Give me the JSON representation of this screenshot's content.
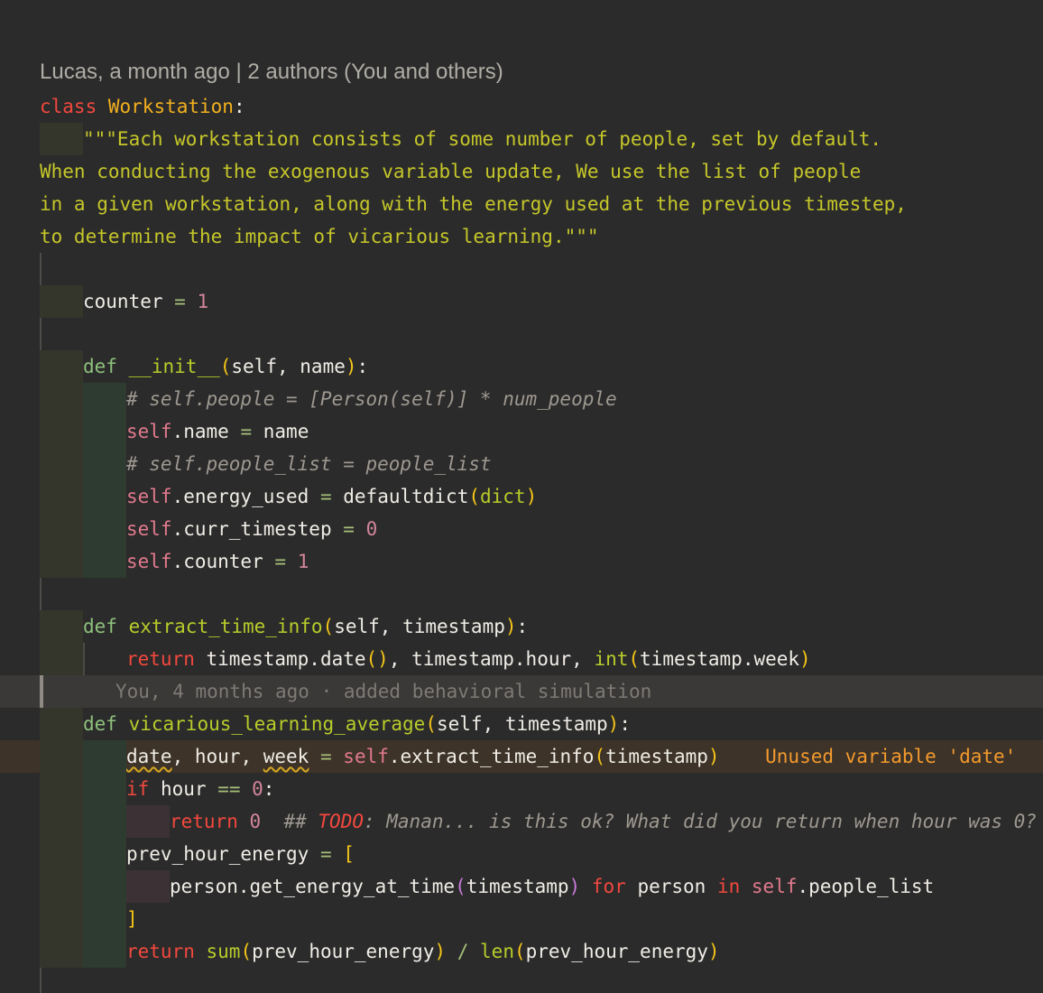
{
  "blame": {
    "header": "Lucas, a month ago | 2 authors (You and others)",
    "inline": "You, 4 months ago · added behavioral simulation"
  },
  "code": {
    "class_kw": "class",
    "class_name": "Workstation",
    "colon": ":",
    "doc1": "\"\"\"Each workstation consists of some number of people, set by default.",
    "doc2": "When conducting the exogenous variable update, We use the list of people",
    "doc3": "in a given workstation, along with the energy used at the previous timestep,",
    "doc4": "to determine the impact of vicarious learning.\"\"\"",
    "counter_name": "counter",
    "counter_val": "1",
    "def": "def",
    "init_name": "__init__",
    "self": "self",
    "name": "name",
    "comment1": "# self.people = [Person(self)] * num_people",
    "comment2": "# self.people_list = people_list",
    "attr_name": ".name",
    "attr_energy": ".energy_used",
    "defaultdict": "defaultdict",
    "dict": "dict",
    "attr_ts": ".curr_timestep",
    "zero": "0",
    "attr_counter": ".counter",
    "one": "1",
    "extract_name": "extract_time_info",
    "timestamp": "timestamp",
    "return": "return",
    "ts_date": "timestamp.date",
    "ts_hour": "timestamp.hour",
    "int": "int",
    "ts_week": "timestamp.week",
    "vla_name": "vicarious_learning_average",
    "date": "date",
    "hour": "hour",
    "week": "week",
    "extract_call": ".extract_time_info",
    "warning": "Unused variable 'date'",
    "if": "if",
    "eqeq": "==",
    "todo_prefix": "## ",
    "todo_tag": "TODO",
    "todo_rest": ": Manan... is this ok? What did you return when hour was 0?",
    "prev": "prev_hour_energy",
    "get_energy": "person.get_energy_at_time",
    "for": "for",
    "person": "person",
    "in": "in",
    "people_list": ".people_list",
    "sum": "sum",
    "len": "len"
  }
}
